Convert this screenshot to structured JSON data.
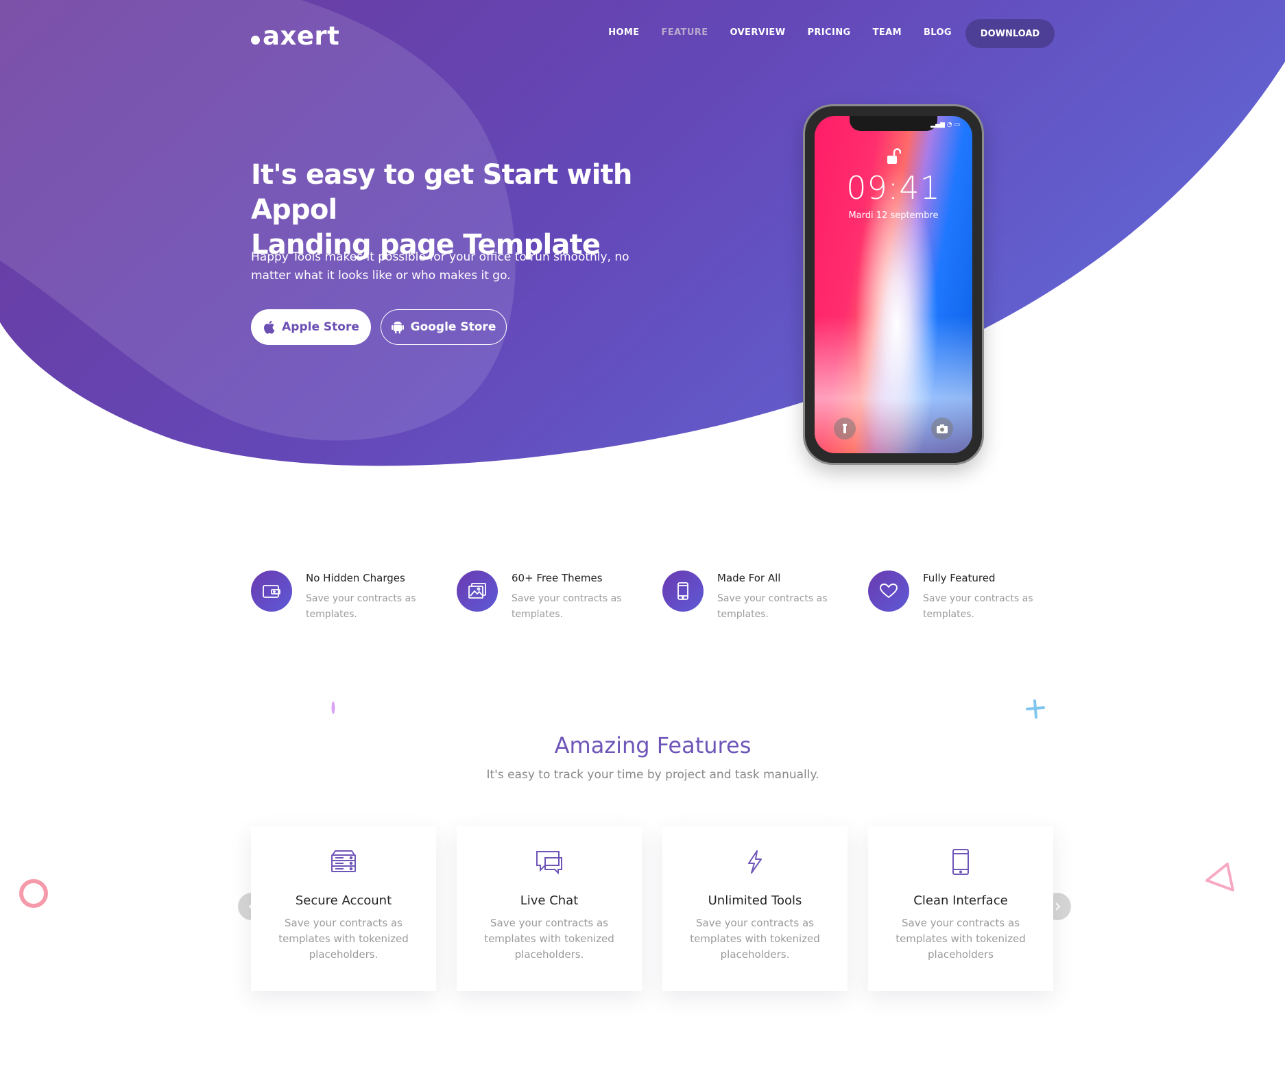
{
  "brand": {
    "logo_text": "axert"
  },
  "nav": {
    "items": [
      {
        "label": "HOME",
        "active": false
      },
      {
        "label": "FEATURE",
        "active": true
      },
      {
        "label": "OVERVIEW",
        "active": false
      },
      {
        "label": "PRICING",
        "active": false
      },
      {
        "label": "TEAM",
        "active": false
      },
      {
        "label": "BLOG",
        "active": false
      }
    ],
    "download_label": "DOWNLOAD"
  },
  "hero": {
    "title_line1": "It's easy to get Start with Appol",
    "title_line2": "Landing page Template",
    "subtitle_line1": "Happy Tools makes it possible for your office to run smoothly, no",
    "subtitle_line2": "matter what it looks like or who makes it go.",
    "apple_label": "Apple Store",
    "google_label": "Google Store"
  },
  "phone": {
    "time": "09:41",
    "date": "Mardi 12 septembre"
  },
  "mini_features": [
    {
      "icon": "wallet-icon",
      "title": "No Hidden Charges",
      "desc": "Save your contracts as templates."
    },
    {
      "icon": "gallery-icon",
      "title": "60+ Free Themes",
      "desc": "Save your contracts as templates."
    },
    {
      "icon": "mobile-icon",
      "title": "Made For All",
      "desc": "Save your contracts as templates."
    },
    {
      "icon": "heart-icon",
      "title": "Fully Featured",
      "desc": "Save your contracts as templates."
    }
  ],
  "features_section": {
    "title": "Amazing Features",
    "subtitle": "It's easy to track your time by project and task manually.",
    "cards": [
      {
        "icon": "server-icon",
        "title": "Secure Account",
        "desc": "Save your contracts as templates with tokenized placeholders."
      },
      {
        "icon": "chat-icon",
        "title": "Live Chat",
        "desc": "Save your contracts as templates with tokenized placeholders."
      },
      {
        "icon": "lightning-icon",
        "title": "Unlimited Tools",
        "desc": "Save your contracts as templates with tokenized placeholders."
      },
      {
        "icon": "smartphone-icon",
        "title": "Clean Interface",
        "desc": "Save your contracts as templates with tokenized placeholders"
      }
    ]
  },
  "colors": {
    "hero_start": "#6a3a9d",
    "hero_end": "#6060cf",
    "accent": "#6e55b8",
    "download_btn": "#4d3f96"
  }
}
